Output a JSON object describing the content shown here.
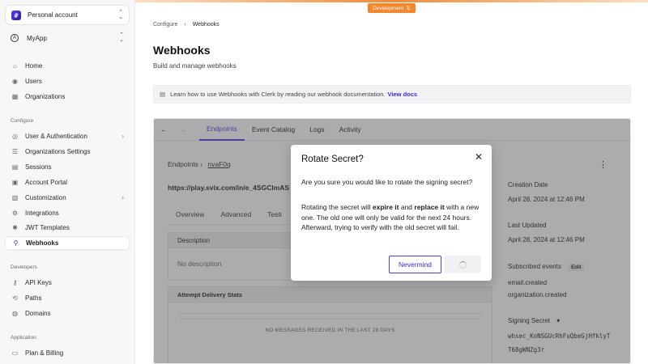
{
  "env_badge": {
    "label": "Development",
    "icon": "swap-icon"
  },
  "sidebar": {
    "account": {
      "name": "Personal account"
    },
    "app": {
      "name": "MyApp"
    },
    "top_items": [
      {
        "label": "Home",
        "icon": "home-icon"
      },
      {
        "label": "Users",
        "icon": "user-icon"
      },
      {
        "label": "Organizations",
        "icon": "building-icon"
      }
    ],
    "configure_label": "Configure",
    "configure_items": [
      {
        "label": "User & Authentication",
        "icon": "user-lock-icon",
        "has_children": true
      },
      {
        "label": "Organizations Settings",
        "icon": "settings-list-icon"
      },
      {
        "label": "Sessions",
        "icon": "sessions-icon"
      },
      {
        "label": "Account Portal",
        "icon": "portal-icon"
      },
      {
        "label": "Customization",
        "icon": "palette-icon",
        "has_children": true
      },
      {
        "label": "Integrations",
        "icon": "integrations-icon"
      },
      {
        "label": "JWT Templates",
        "icon": "jwt-icon"
      },
      {
        "label": "Webhooks",
        "icon": "webhook-icon",
        "active": true
      }
    ],
    "developers_label": "Developers",
    "developer_items": [
      {
        "label": "API Keys",
        "icon": "key-icon"
      },
      {
        "label": "Paths",
        "icon": "paths-icon"
      },
      {
        "label": "Domains",
        "icon": "globe-icon"
      }
    ],
    "application_label": "Application",
    "application_items": [
      {
        "label": "Plan & Billing",
        "icon": "billing-icon"
      }
    ]
  },
  "breadcrumb": {
    "parent": "Configure",
    "current": "Webhooks"
  },
  "page": {
    "title": "Webhooks",
    "subtitle": "Build and manage webhooks",
    "info_text": "Learn how to use Webhooks with Clerk by reading our webhook documentation.",
    "info_link": "View docs"
  },
  "panel": {
    "tabs": [
      "Endpoints",
      "Event Catalog",
      "Logs",
      "Activity"
    ],
    "endpoint_crumb": "Endpoints",
    "endpoint_id": "nvaF0q",
    "endpoint_url": "https://play.svix.com/in/e_4SGClmAS",
    "subtabs": [
      "Overview",
      "Advanced",
      "Testi"
    ],
    "description_label": "Description",
    "description_value": "No description",
    "stats_label": "Attempt Delivery Stats",
    "stats_empty": "NO MESSAGES RECEIVED IN THE LAST 28 DAYS",
    "creation_label": "Creation Date",
    "creation_value": "April 28, 2024 at 12:46 PM",
    "updated_label": "Last Updated",
    "updated_value": "April 28, 2024 at 12:46 PM",
    "events_label": "Subscribed events",
    "events_edit": "Edit",
    "events": [
      "email.created",
      "organization.created"
    ],
    "secret_label": "Signing Secret",
    "secret_line1": "whsec_KoNSGUcRhFuQbeGjHfklyT",
    "secret_line2": "T68gWNZg3r"
  },
  "modal": {
    "title": "Rotate Secret?",
    "question": "Are you sure you would like to rotate the signing secret?",
    "body_1": "Rotating the secret will ",
    "body_bold_1": "expire it",
    "body_2": " and ",
    "body_bold_2": "replace it",
    "body_3": " with a new one. The old one will only be valid for the next 24 hours. Afterward, trying to verify with the old secret will fail.",
    "cancel_label": "Nevermind"
  }
}
